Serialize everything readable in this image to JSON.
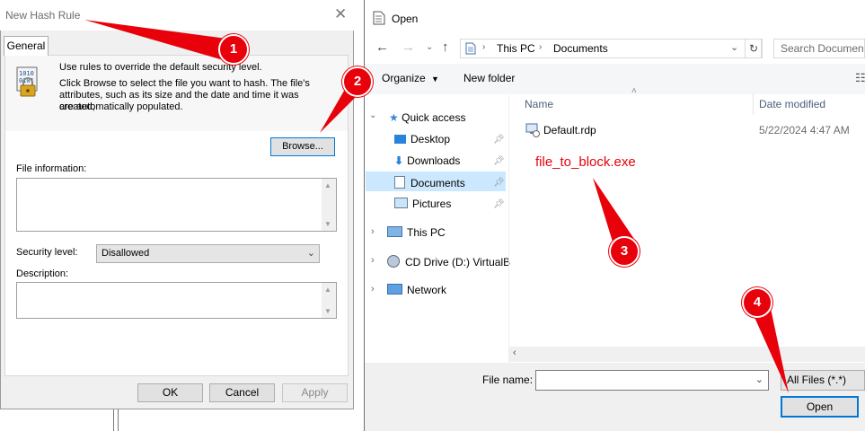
{
  "hash_dialog": {
    "title": "New Hash Rule",
    "close_glyph": "✕",
    "tab": "General",
    "info_line1": "Use rules to override the default security level.",
    "info_line2": "Click Browse to select the file you want to hash. The file's",
    "info_line3": "attributes, such as its size and the date and time it was created,",
    "info_line4": "are automatically populated.",
    "browse_label": "Browse...",
    "file_info_label": "File information:",
    "security_level_label": "Security level:",
    "security_level_value": "Disallowed",
    "description_label": "Description:",
    "ok_label": "OK",
    "cancel_label": "Cancel",
    "apply_label": "Apply"
  },
  "open_dialog": {
    "title": "Open",
    "breadcrumb": [
      "This PC",
      "Documents"
    ],
    "search_placeholder": "Search Documents",
    "toolbar": {
      "organize_label": "Organize",
      "new_folder_label": "New folder"
    },
    "sidebar": {
      "quick_access": "Quick access",
      "items": [
        "Desktop",
        "Downloads",
        "Documents",
        "Pictures"
      ],
      "this_pc": "This PC",
      "cd_drive": "CD Drive (D:) VirtualB",
      "network": "Network"
    },
    "columns": {
      "name": "Name",
      "date_modified": "Date modified"
    },
    "files": [
      {
        "name": "Default.rdp",
        "date": "5/22/2024 4:47 AM"
      }
    ],
    "file_name_label": "File name:",
    "file_name_value": "",
    "filter_value": "All Files (*.*)",
    "open_label": "Open"
  },
  "annotations": {
    "markers": [
      "1",
      "2",
      "3",
      "4"
    ],
    "callout_text": "file_to_block.exe",
    "color": "#e8000a"
  }
}
